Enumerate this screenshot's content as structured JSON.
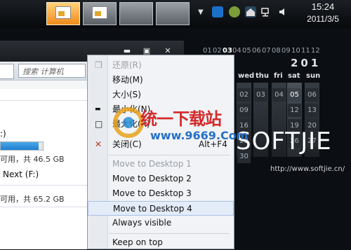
{
  "clock": {
    "time": "15:24",
    "date": "2011/3/5"
  },
  "taskbar": {
    "tray_arrow": "▼"
  },
  "explorer": {
    "search_placeholder": "搜索 计算机",
    "drives": [
      {
        "label": ":)",
        "size_text": "可用，共 46.5 GB",
        "used_fraction": 0.9
      },
      {
        "label": "Next (F:)",
        "size_text": "可用，共 65.2 GB"
      }
    ],
    "caption_buttons": {
      "minimize": "▬",
      "maximize": "▣",
      "close": "✕"
    }
  },
  "menu": {
    "items": [
      {
        "label": "还原(R)",
        "disabled": true,
        "icon": "restore-icon",
        "glyph": "❐"
      },
      {
        "label": "移动(M)",
        "disabled": false
      },
      {
        "label": "大小(S)",
        "disabled": false
      },
      {
        "label": "最小化(N)",
        "disabled": false,
        "icon": "minimize-icon",
        "glyph": "▬"
      },
      {
        "label": "最大化(X)",
        "disabled": false,
        "icon": "maximize-icon",
        "glyph": "□"
      },
      {
        "label": "关闭(C)",
        "disabled": false,
        "icon": "close-icon",
        "glyph": "✕",
        "accel": "Alt+F4"
      },
      {
        "label": "Move to Desktop 1",
        "disabled": true
      },
      {
        "label": "Move to Desktop 2",
        "disabled": false
      },
      {
        "label": "Move to Desktop 3",
        "disabled": false
      },
      {
        "label": "Move to Desktop 4",
        "disabled": false,
        "highlighted": true
      },
      {
        "label": "Always visible",
        "disabled": false
      },
      {
        "label": "Keep on top",
        "disabled": false
      }
    ]
  },
  "calendar": {
    "header_days": [
      "01",
      "02",
      "03",
      "04",
      "05",
      "06",
      "07",
      "08",
      "09",
      "10",
      "11",
      "12"
    ],
    "year": "201",
    "weekday_labels": [
      "wed",
      "thu",
      "fri",
      "sat",
      "sun"
    ],
    "cells": [
      "02",
      "03",
      "04",
      "05",
      "06",
      "09",
      "12",
      "13",
      "16",
      "19",
      "20",
      "23",
      "26",
      "27",
      "30"
    ]
  },
  "watermark": {
    "brand": "统一下载站",
    "url": "www.9669.Com"
  },
  "softjie": {
    "logo": "SOFTJIE",
    "url": "http://www.softjie.cn/"
  },
  "colors": {
    "accent_orange": "#f08a1a",
    "drive_bar_blue": "#1f7fd0",
    "menu_highlight": "#e3ecf8",
    "close_red": "#c0392b"
  }
}
